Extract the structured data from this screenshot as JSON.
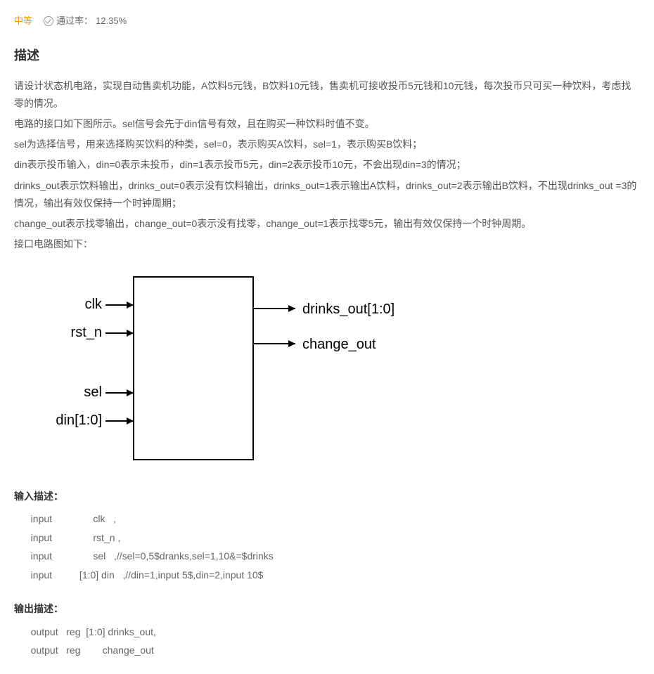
{
  "meta": {
    "difficulty": "中等",
    "pass_rate_label": "通过率：",
    "pass_rate_value": "12.35%"
  },
  "sections": {
    "description_title": "描述",
    "input_title": "输入描述：",
    "output_title": "输出描述："
  },
  "description": {
    "p1": "请设计状态机电路，实现自动售卖机功能，A饮料5元钱，B饮料10元钱，售卖机可接收投币5元钱和10元钱，每次投币只可买一种饮料，考虑找零的情况。",
    "p2": "电路的接口如下图所示。sel信号会先于din信号有效，且在购买一种饮料时值不变。",
    "p3": "sel为选择信号，用来选择购买饮料的种类，sel=0，表示购买A饮料，sel=1，表示购买B饮料；",
    "p4": "din表示投币输入，din=0表示未投币，din=1表示投币5元，din=2表示投币10元，不会出现din=3的情况；",
    "p5": "drinks_out表示饮料输出，drinks_out=0表示没有饮料输出，drinks_out=1表示输出A饮料，drinks_out=2表示输出B饮料，不出现drinks_out =3的情况，输出有效仅保持一个时钟周期；",
    "p6": "change_out表示找零输出，change_out=0表示没有找零，change_out=1表示找零5元，输出有效仅保持一个时钟周期。",
    "p7": "接口电路图如下："
  },
  "diagram": {
    "inputs": {
      "clk": "clk",
      "rst_n": "rst_n",
      "sel": "sel",
      "din": "din[1:0]"
    },
    "outputs": {
      "drinks_out": "drinks_out[1:0]",
      "change_out": "change_out"
    }
  },
  "input_desc": {
    "l1": "   input               clk   ,",
    "l2": "   input               rst_n ,",
    "l3": "   input               sel   ,//sel=0,5$dranks,sel=1,10&=$drinks",
    "l4": "   input          [1:0] din   ,//din=1,input 5$,din=2,input 10$"
  },
  "output_desc": {
    "l1": "   output   reg  [1:0] drinks_out,",
    "l2": "   output   reg        change_out"
  }
}
